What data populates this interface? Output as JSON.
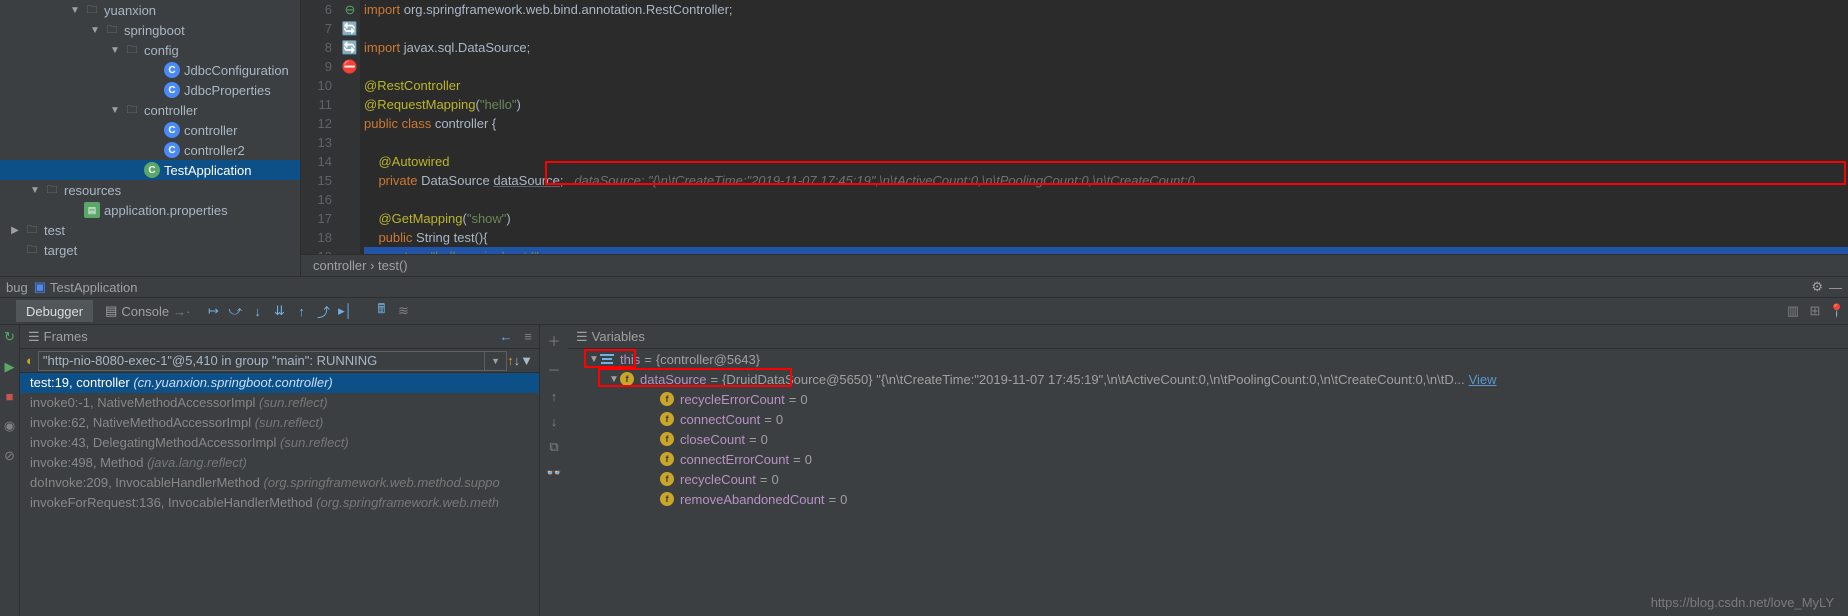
{
  "tree": [
    {
      "indent": 70,
      "chev": "▼",
      "icon": "folder",
      "label": "yuanxion"
    },
    {
      "indent": 90,
      "chev": "▼",
      "icon": "folder",
      "label": "springboot"
    },
    {
      "indent": 110,
      "chev": "▼",
      "icon": "folder",
      "label": "config"
    },
    {
      "indent": 150,
      "chev": "",
      "icon": "class",
      "label": "JdbcConfiguration"
    },
    {
      "indent": 150,
      "chev": "",
      "icon": "class",
      "label": "JdbcProperties"
    },
    {
      "indent": 110,
      "chev": "▼",
      "icon": "folder",
      "label": "controller"
    },
    {
      "indent": 150,
      "chev": "",
      "icon": "class",
      "label": "controller"
    },
    {
      "indent": 150,
      "chev": "",
      "icon": "class",
      "label": "controller2"
    },
    {
      "indent": 130,
      "chev": "",
      "icon": "run",
      "label": "TestApplication",
      "sel": true
    },
    {
      "indent": 30,
      "chev": "▼",
      "icon": "folder",
      "label": "resources"
    },
    {
      "indent": 70,
      "chev": "",
      "icon": "leaf",
      "label": "application.properties"
    },
    {
      "indent": 10,
      "chev": "▶",
      "icon": "folder",
      "label": "test"
    },
    {
      "indent": 10,
      "chev": "",
      "icon": "folder",
      "label": "target"
    }
  ],
  "editor": {
    "first_line": 6,
    "lines": [
      {
        "html": "<span class='kw'>import</span> org.springframework.web.bind.annotation.RestController;"
      },
      {
        "html": ""
      },
      {
        "html": "<span class='kw'>import</span> javax.sql.DataSource;"
      },
      {
        "html": ""
      },
      {
        "html": "<span class='an'>@RestController</span>",
        "gut": "⊖"
      },
      {
        "html": "<span class='an'>@RequestMapping</span>(<span class='str'>\"hello\"</span>)"
      },
      {
        "html": "<span class='kw'>public class</span> controller {",
        "gut": "🔄"
      },
      {
        "html": ""
      },
      {
        "html": "    <span class='an'>@Autowired</span>"
      },
      {
        "html": "    <span class='kw'>private</span> DataSource <span class='und'>dataSource</span>;   <span class='hint'>dataSource: \"{\\n\\tCreateTime:\"2019-11-07 17:45:19\",\\n\\tActiveCount:0,\\n\\tPoolingCount:0,\\n\\tCreateCount:0</span>",
        "gut": "🔄"
      },
      {
        "html": ""
      },
      {
        "html": "    <span class='an'>@GetMapping</span>(<span class='str'>\"show\"</span>)"
      },
      {
        "html": "    <span class='kw'>public</span> String test(){"
      },
      {
        "html": "        <span class='kw'>return</span> <span class='str'>\"hello springboot !\"</span>;",
        "exec": true,
        "gut": "⛔"
      }
    ],
    "crumbs": "controller  ›  test()"
  },
  "debug": {
    "header_prefix": "bug",
    "header_title": "TestApplication",
    "tabs": {
      "debugger": "Debugger",
      "console": "Console"
    },
    "frames_title": "Frames",
    "vars_title": "Variables",
    "thread": "\"http-nio-8080-exec-1\"@5,410 in group \"main\": RUNNING",
    "frames": [
      {
        "txt": "test:19, controller ",
        "pkg": "(cn.yuanxion.springboot.controller)",
        "top": true
      },
      {
        "txt": "invoke0:-1, NativeMethodAccessorImpl ",
        "pkg": "(sun.reflect)"
      },
      {
        "txt": "invoke:62, NativeMethodAccessorImpl ",
        "pkg": "(sun.reflect)"
      },
      {
        "txt": "invoke:43, DelegatingMethodAccessorImpl ",
        "pkg": "(sun.reflect)"
      },
      {
        "txt": "invoke:498, Method ",
        "pkg": "(java.lang.reflect)"
      },
      {
        "txt": "doInvoke:209, InvocableHandlerMethod ",
        "pkg": "(org.springframework.web.method.suppo"
      },
      {
        "txt": "invokeForRequest:136, InvocableHandlerMethod ",
        "pkg": "(org.springframework.web.meth"
      }
    ],
    "vars": {
      "this_label": "this",
      "this_val": "{controller@5643}",
      "ds_label": "dataSource",
      "ds_val": "{DruidDataSource@5650} \"{\\n\\tCreateTime:\"2019-11-07 17:45:19\",\\n\\tActiveCount:0,\\n\\tPoolingCount:0,\\n\\tCreateCount:0,\\n\\tD...",
      "view": "View",
      "fields": [
        {
          "n": "recycleErrorCount",
          "v": "0"
        },
        {
          "n": "connectCount",
          "v": "0"
        },
        {
          "n": "closeCount",
          "v": "0"
        },
        {
          "n": "connectErrorCount",
          "v": "0"
        },
        {
          "n": "recycleCount",
          "v": "0"
        },
        {
          "n": "removeAbandonedCount",
          "v": "0"
        }
      ]
    }
  },
  "watermark": "https://blog.csdn.net/love_MyLY"
}
